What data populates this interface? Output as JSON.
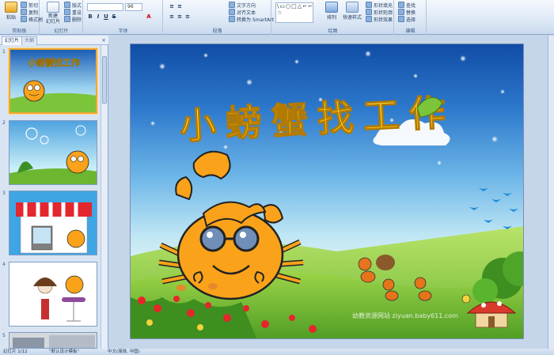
{
  "ribbon": {
    "clipboard": {
      "paste": "粘贴",
      "cut": "剪切",
      "copy": "复制",
      "format_painter": "格式刷",
      "label": "剪贴板"
    },
    "slides": {
      "new_slide": "新建\n幻灯片",
      "layout": "版式",
      "reset": "重设",
      "delete": "删除",
      "label": "幻灯片"
    },
    "font": {
      "size": "96",
      "label": "字体"
    },
    "paragraph": {
      "text_direction": "文字方向",
      "align_text": "对齐文本",
      "smartart": "转换为 SmartArt",
      "label": "段落"
    },
    "drawing": {
      "arrange": "排列",
      "quick_styles": "快速样式",
      "shape_fill": "形状填充",
      "shape_outline": "形状轮廓",
      "shape_effects": "形状效果",
      "label": "绘图",
      "shape_glyphs": "\\▭○□△⌐⌐↗↘⇒⇧☆⌒{}☆"
    },
    "editing": {
      "find": "查找",
      "replace": "替换",
      "select": "选择",
      "label": "编辑"
    }
  },
  "panel": {
    "tab_slides": "幻灯片",
    "tab_outline": "大纲",
    "close": "×",
    "thumbs": [
      "1",
      "2",
      "3",
      "4",
      "5"
    ]
  },
  "slide": {
    "title": "小螃蟹找工作",
    "watermark": "幼教资源网站 ziyuan.baby611.com"
  },
  "status": {
    "slide_info": "幻灯片 1/12",
    "theme": "\"默认设计模板\"",
    "language": "中文(简体, 中国)"
  },
  "colors": {
    "title_yellow": "#ffe600",
    "crab_orange": "#f9a21a",
    "grass": "#7cc43a",
    "selection": "#f3a62f"
  }
}
